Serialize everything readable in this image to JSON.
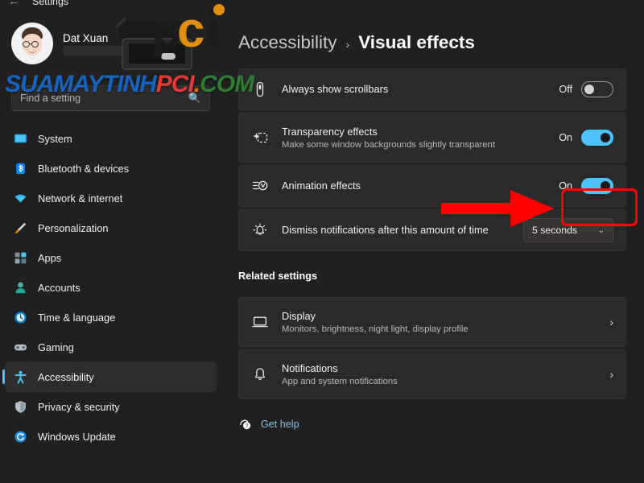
{
  "titlebar": {
    "back_icon": "back-arrow-icon",
    "title": "Settings"
  },
  "sidebar": {
    "profile": {
      "name": "Dat Xuan",
      "avatar_icon": "user-avatar-icon"
    },
    "search": {
      "placeholder": "Find a setting",
      "value": "",
      "icon": "search-icon"
    },
    "items": [
      {
        "label": "System",
        "icon": "monitor-icon",
        "active": false
      },
      {
        "label": "Bluetooth & devices",
        "icon": "bluetooth-icon",
        "active": false
      },
      {
        "label": "Network & internet",
        "icon": "wifi-icon",
        "active": false
      },
      {
        "label": "Personalization",
        "icon": "paintbrush-icon",
        "active": false
      },
      {
        "label": "Apps",
        "icon": "apps-grid-icon",
        "active": false
      },
      {
        "label": "Accounts",
        "icon": "person-icon",
        "active": false
      },
      {
        "label": "Time & language",
        "icon": "clock-globe-icon",
        "active": false
      },
      {
        "label": "Gaming",
        "icon": "gamepad-icon",
        "active": false
      },
      {
        "label": "Accessibility",
        "icon": "accessibility-icon",
        "active": true
      },
      {
        "label": "Privacy & security",
        "icon": "shield-icon",
        "active": false
      },
      {
        "label": "Windows Update",
        "icon": "update-refresh-icon",
        "active": false
      }
    ]
  },
  "breadcrumb": {
    "parent": "Accessibility",
    "separator": "›",
    "current": "Visual effects"
  },
  "settings": [
    {
      "icon": "scrollbar-icon",
      "title": "Always show scrollbars",
      "subtitle": "",
      "control": "toggle",
      "state_label": "Off",
      "state": "off"
    },
    {
      "icon": "transparency-sparkle-icon",
      "title": "Transparency effects",
      "subtitle": "Make some window backgrounds slightly transparent",
      "control": "toggle",
      "state_label": "On",
      "state": "on"
    },
    {
      "icon": "animation-effects-icon",
      "title": "Animation effects",
      "subtitle": "",
      "control": "toggle",
      "state_label": "On",
      "state": "on",
      "highlighted": true
    },
    {
      "icon": "notification-bell-alert-icon",
      "title": "Dismiss notifications after this amount of time",
      "subtitle": "",
      "control": "dropdown",
      "value": "5 seconds",
      "caret": "˅"
    }
  ],
  "related": {
    "heading": "Related settings",
    "items": [
      {
        "icon": "display-monitor-icon",
        "title": "Display",
        "subtitle": "Monitors, brightness, night light, display profile",
        "chevron": "›"
      },
      {
        "icon": "bell-icon",
        "title": "Notifications",
        "subtitle": "App and system notifications",
        "chevron": "›"
      }
    ]
  },
  "footer": {
    "help_icon": "help-question-icon",
    "help_label": "Get help"
  },
  "watermark": {
    "logo_text": "pci",
    "site_parts": [
      {
        "text": "SUAMAYTINH",
        "color": "#1565c0"
      },
      {
        "text": "PCI",
        "color": "#e53935"
      },
      {
        "text": ".",
        "color": "#ef6c00"
      },
      {
        "text": "COM",
        "color": "#2e7d32"
      }
    ]
  },
  "annotation": {
    "arrow_color": "#ff0000",
    "box_color": "#ff0000"
  },
  "colors": {
    "accent": "#4cc2ff",
    "background": "#202020",
    "card": "#2b2a2a",
    "link": "#84c6ef"
  }
}
